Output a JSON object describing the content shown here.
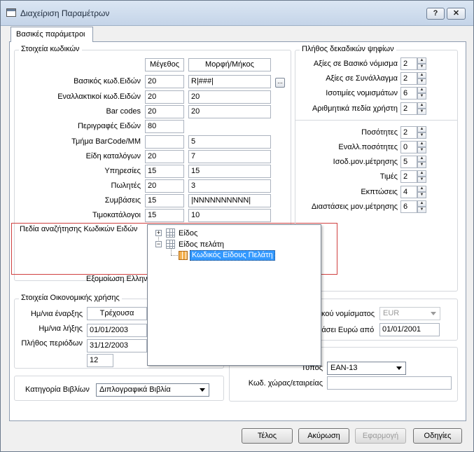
{
  "window": {
    "title": "Διαχείριση Παραμέτρων",
    "help_label": "?",
    "close_label": "✕"
  },
  "tab": {
    "label": "Βασικές παράμετροι"
  },
  "codes": {
    "legend": "Στοιχεία κωδικών",
    "col_size": "Μέγεθος",
    "col_format": "Μορφή/Μήκος",
    "rows": [
      {
        "label": "Βασικός κωδ.Ειδών",
        "size": "20",
        "format": "R|###|"
      },
      {
        "label": "Εναλλακτικοί  κωδ.Ειδών",
        "size": "20",
        "format": "20"
      },
      {
        "label": "Bar codes",
        "size": "20",
        "format": "20"
      },
      {
        "label": "Περιγραφές Ειδών",
        "size": "80",
        "format": ""
      },
      {
        "label": "Τμήμα BarCode/MM",
        "size": "",
        "format": "5"
      },
      {
        "label": "Είδη καταλόγων",
        "size": "20",
        "format": "7"
      },
      {
        "label": "Υπηρεσίες",
        "size": "15",
        "format": "15"
      },
      {
        "label": "Πωλητές",
        "size": "20",
        "format": "3"
      },
      {
        "label": "Συμβάσεις",
        "size": "15",
        "format": "|NNNNNNNNNN|"
      },
      {
        "label": "Τιμοκατάλογοι",
        "size": "15",
        "format": "10"
      }
    ],
    "search_fields_label": "Πεδία αναζήτησης Κωδικών Ειδών",
    "greek_label": "Εξομοίωση Ελλην"
  },
  "tree": {
    "items": [
      {
        "label": "Είδος",
        "expander": "+"
      },
      {
        "label": "Είδος πελάτη",
        "expander": "−"
      },
      {
        "label": "Κωδικός Είδους Πελάτη"
      }
    ]
  },
  "decimals": {
    "legend": "Πλήθος δεκαδικών ψηφίων",
    "rows1": [
      {
        "label": "Αξίες σε Βασικό νόμισμα",
        "value": "2"
      },
      {
        "label": "Αξίες σε Συνάλλαγμα",
        "value": "2"
      },
      {
        "label": "Ισοτιμίες νομισμάτων",
        "value": "6"
      },
      {
        "label": "Αριθμητικά πεδία χρήστη",
        "value": "2"
      }
    ],
    "rows2": [
      {
        "label": "Ποσότητες",
        "value": "2"
      },
      {
        "label": "Εναλλ.ποσότητες",
        "value": "0"
      },
      {
        "label": "Ισοδ.μον.μέτρησης",
        "value": "5"
      },
      {
        "label": "Τιμές",
        "value": "2"
      },
      {
        "label": "Εκπτώσεις",
        "value": "4"
      },
      {
        "label": "Διαστάσεις μον.μέτρησης",
        "value": "6"
      }
    ]
  },
  "fiscal": {
    "legend": "Στοιχεία Οικονομικής χρήσης",
    "start_label": "Ημ/νια έναρξης",
    "end_label": "Ημ/νια λήξης",
    "periods_label": "Πλήθος περιόδων",
    "current_header": "Τρέχουσα",
    "start_value": "01/01/2003",
    "end_value": "31/12/2003",
    "periods_value": "12"
  },
  "currency": {
    "base_label": "κού νομίσματος",
    "base_value": "EUR",
    "euro_label": "βάσει Ευρώ από",
    "euro_value": "01/01/2001"
  },
  "barcode": {
    "type_label": "Τύπος",
    "type_value": "EAN-13",
    "country_label": "Κωδ. χώρας/εταιρείας",
    "country_value": ""
  },
  "books": {
    "label": "Κατηγορία Βιβλίων",
    "value": "Διπλογραφικά Βιβλία"
  },
  "buttons": {
    "ok": "Τέλος",
    "cancel": "Ακύρωση",
    "apply": "Εφαρμογή",
    "help": "Οδηγίες"
  }
}
